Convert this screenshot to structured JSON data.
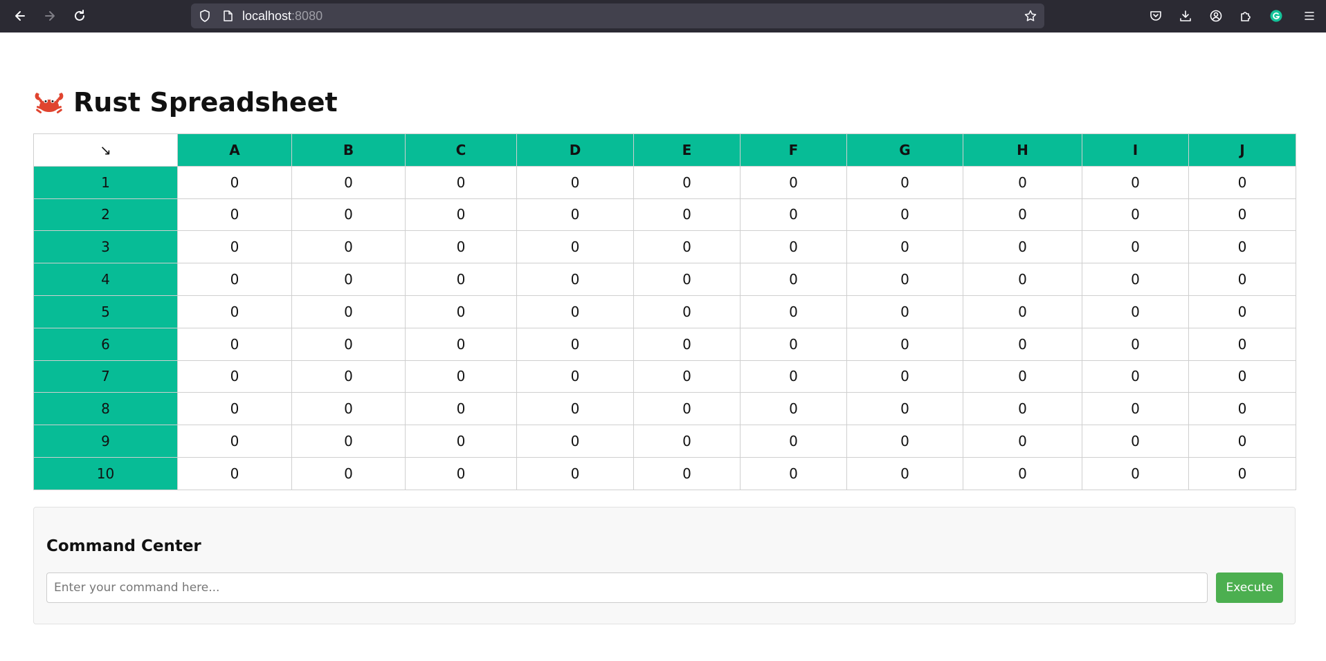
{
  "browser": {
    "url_host": "localhost",
    "url_port": ":8080"
  },
  "page": {
    "emoji": "🦀",
    "title": "Rust Spreadsheet"
  },
  "sheet": {
    "corner": "↘",
    "columns": [
      "A",
      "B",
      "C",
      "D",
      "E",
      "F",
      "G",
      "H",
      "I",
      "J"
    ],
    "rows": [
      {
        "label": "1",
        "cells": [
          "0",
          "0",
          "0",
          "0",
          "0",
          "0",
          "0",
          "0",
          "0",
          "0"
        ]
      },
      {
        "label": "2",
        "cells": [
          "0",
          "0",
          "0",
          "0",
          "0",
          "0",
          "0",
          "0",
          "0",
          "0"
        ]
      },
      {
        "label": "3",
        "cells": [
          "0",
          "0",
          "0",
          "0",
          "0",
          "0",
          "0",
          "0",
          "0",
          "0"
        ]
      },
      {
        "label": "4",
        "cells": [
          "0",
          "0",
          "0",
          "0",
          "0",
          "0",
          "0",
          "0",
          "0",
          "0"
        ]
      },
      {
        "label": "5",
        "cells": [
          "0",
          "0",
          "0",
          "0",
          "0",
          "0",
          "0",
          "0",
          "0",
          "0"
        ]
      },
      {
        "label": "6",
        "cells": [
          "0",
          "0",
          "0",
          "0",
          "0",
          "0",
          "0",
          "0",
          "0",
          "0"
        ]
      },
      {
        "label": "7",
        "cells": [
          "0",
          "0",
          "0",
          "0",
          "0",
          "0",
          "0",
          "0",
          "0",
          "0"
        ]
      },
      {
        "label": "8",
        "cells": [
          "0",
          "0",
          "0",
          "0",
          "0",
          "0",
          "0",
          "0",
          "0",
          "0"
        ]
      },
      {
        "label": "9",
        "cells": [
          "0",
          "0",
          "0",
          "0",
          "0",
          "0",
          "0",
          "0",
          "0",
          "0"
        ]
      },
      {
        "label": "10",
        "cells": [
          "0",
          "0",
          "0",
          "0",
          "0",
          "0",
          "0",
          "0",
          "0",
          "0"
        ]
      }
    ]
  },
  "command_center": {
    "title": "Command Center",
    "input_value": "",
    "input_placeholder": "Enter your command here...",
    "execute_label": "Execute"
  },
  "colors": {
    "header_accent": "#07bc96",
    "execute_button": "#4caf50",
    "browser_toolbar": "#2b2a33"
  }
}
